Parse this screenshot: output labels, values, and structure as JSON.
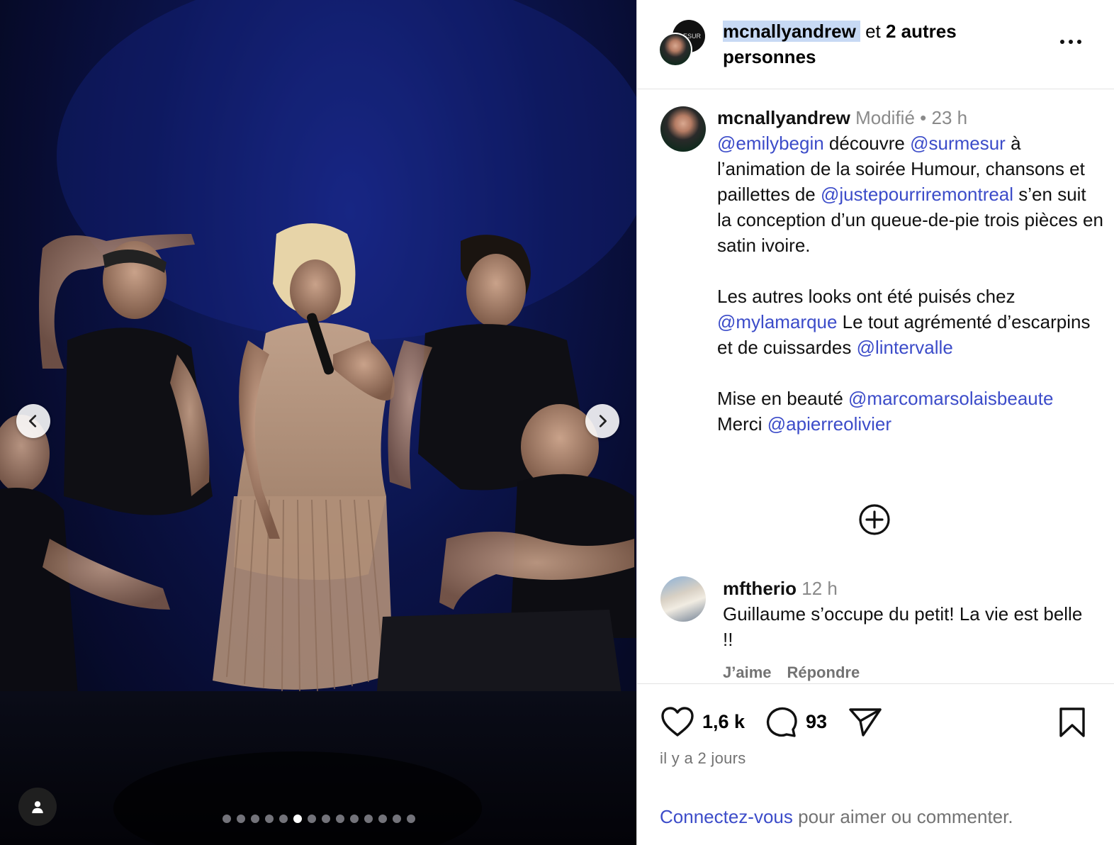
{
  "header": {
    "username": "mcnallyandrew",
    "joiner": " et ",
    "others": "2 autres personnes",
    "second_avatar_text": "ESUR"
  },
  "caption": {
    "username": "mcnallyandrew",
    "edited": "Modifié",
    "separator": " • ",
    "time": "23 h",
    "p1": {
      "mention1": "@emilybegin",
      "t1": " découvre ",
      "mention2": "@surmesur",
      "t2": " à l’animation de la soirée Humour, chansons et paillettes de ",
      "mention3": "@justepourriremontreal",
      "t3": " s’en suit la conception d’un queue-de-pie trois pièces en satin ivoire."
    },
    "p2": {
      "t1": "Les autres looks ont été puisés chez ",
      "mention1": "@mylamarque",
      "t2": " Le tout agrémenté d’escarpins et de cuissardes ",
      "mention2": "@lintervalle"
    },
    "p3": {
      "t1": "Mise en beauté ",
      "mention1": "@marcomarsolaisbeaute",
      "t2": "Merci ",
      "mention2": "@apierreolivier"
    }
  },
  "comment": {
    "username": "mftherio",
    "time": "12 h",
    "text": "Guillaume s’occupe du petit! La vie est belle !!",
    "like_label": "J’aime",
    "reply_label": "Répondre"
  },
  "actions": {
    "likes": "1,6 k",
    "comments": "93",
    "posted": "il y a 2 jours",
    "login_link": "Connectez-vous",
    "login_rest": " pour aimer ou commenter."
  },
  "carousel": {
    "total_slides": 14,
    "active_index": 5
  },
  "icons": {
    "prev": "chevron-left-icon",
    "next": "chevron-right-icon",
    "tags": "user-tag-icon",
    "more": "more-options-icon",
    "load_more": "plus-circle-icon",
    "like": "heart-icon",
    "comment": "comment-bubble-icon",
    "share": "paper-plane-icon",
    "save": "bookmark-icon"
  },
  "colors": {
    "link": "#3c4cc9",
    "muted": "#737373",
    "selection": "#c7d9f4"
  }
}
